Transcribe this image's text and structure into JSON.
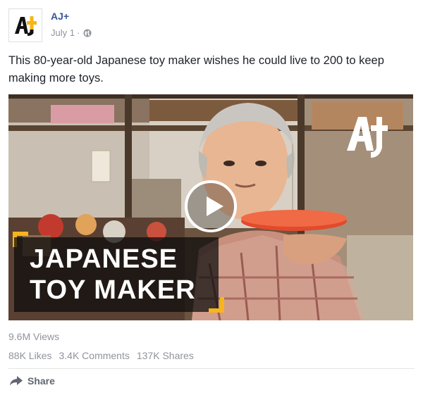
{
  "post": {
    "page_name": "AJ+",
    "date": "July 1",
    "separator": "·",
    "privacy_icon": "globe-icon",
    "avatar_icon": "aj-plus-logo-icon",
    "text": "This 80-year-old Japanese toy maker wishes he could live to 200 to keep making more toys."
  },
  "video": {
    "caption_line1": "JAPANESE",
    "caption_line2": "TOY MAKER",
    "play_icon": "play-icon",
    "watermark_icon": "aj-plus-logo-icon",
    "accent_color": "#f7b51b"
  },
  "stats": {
    "views": "9.6M Views",
    "likes": "88K Likes",
    "comments": "3.4K Comments",
    "shares": "137K Shares"
  },
  "actions": {
    "share_label": "Share",
    "share_icon": "share-arrow-icon"
  },
  "colors": {
    "page_name": "#365899",
    "meta_text": "#90949c",
    "brand_yellow": "#f7b51b"
  }
}
